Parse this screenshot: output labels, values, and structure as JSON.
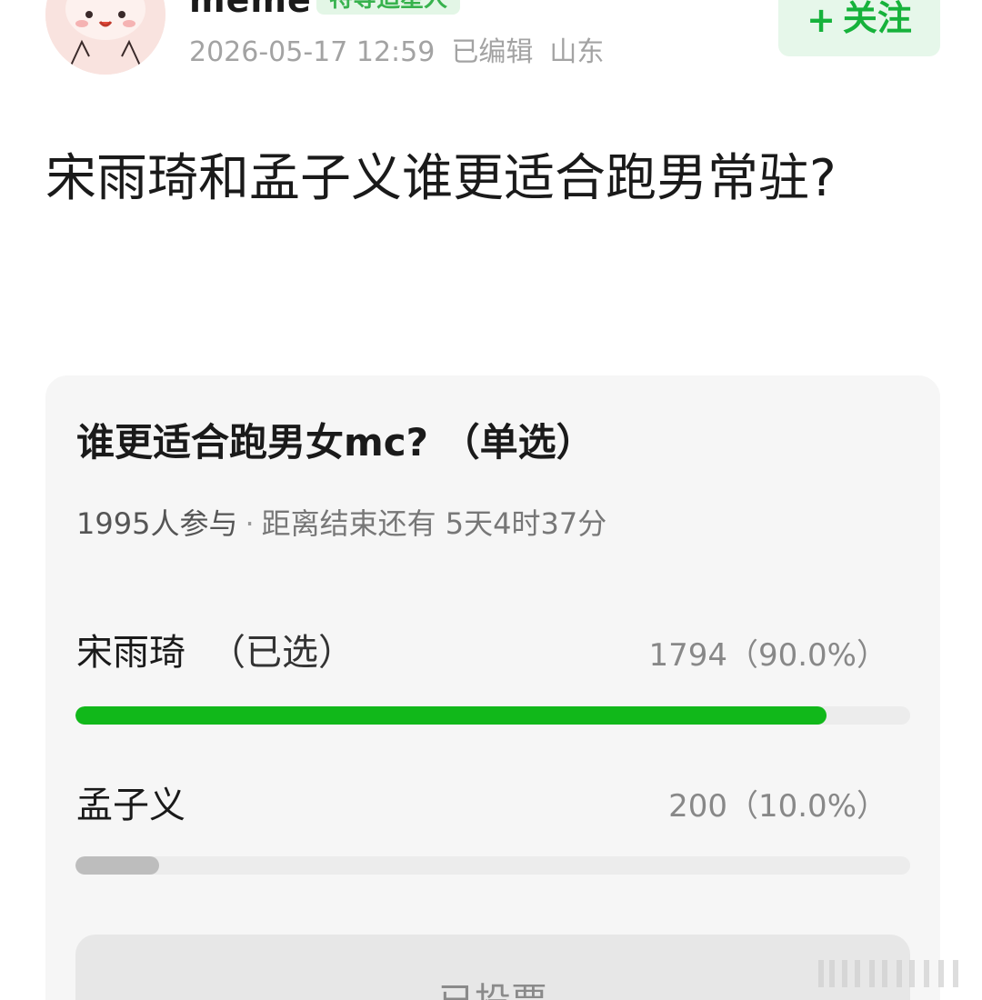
{
  "header": {
    "username": "meme",
    "user_badge": "特等追星人",
    "timestamp": "2026-05-17 12:59",
    "edited": "已编辑",
    "location": "山东",
    "follow_plus": "+",
    "follow_label": "关注"
  },
  "post": {
    "title": "宋雨琦和孟子义谁更适合跑男常驻?"
  },
  "poll": {
    "title": "谁更适合跑男女mc? （单选）",
    "participants": "1995人参与",
    "separator": "·",
    "remaining": "距离结束还有 5天4时37分",
    "options": [
      {
        "label": "宋雨琦",
        "selected_tag": "（已选）",
        "count": "1794（90.0%）",
        "fraction": 0.9,
        "color": "#11b81a"
      },
      {
        "label": "孟子义",
        "selected_tag": "",
        "count": "200（10.0%）",
        "fraction": 0.1,
        "color": "#bdbdbd"
      }
    ],
    "vote_button": "已投票"
  },
  "icons": {
    "avatar": "avatar-cartoon-icon",
    "watermark": "weibo-watermark-icon"
  }
}
